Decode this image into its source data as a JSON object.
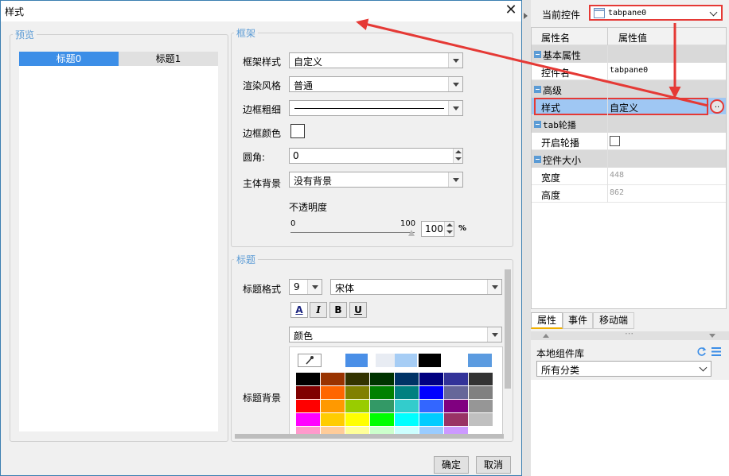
{
  "dialog": {
    "title": "样式",
    "close_glyph": "✕",
    "ok_label": "确定",
    "cancel_label": "取消"
  },
  "preview": {
    "group_label": "预览",
    "tabs": [
      "标题0",
      "标题1"
    ]
  },
  "frame": {
    "group_label": "框架",
    "style_label": "框架样式",
    "style_value": "自定义",
    "render_label": "渲染风格",
    "render_value": "普通",
    "border_width_label": "边框粗细",
    "border_color_label": "边框颜色",
    "radius_label": "圆角:",
    "radius_value": "0",
    "background_label": "主体背景",
    "background_value": "没有背景",
    "opacity_label": "不透明度",
    "opacity_min": "0",
    "opacity_max": "100",
    "opacity_value": "100",
    "opacity_unit": "%",
    "opacity_level": 1.0
  },
  "title_section": {
    "group_label": "标题",
    "format_label": "标题格式",
    "font_size": "9",
    "font_name": "宋体",
    "bold_glyph": "B",
    "italic_glyph": "I",
    "underline_glyph": "U",
    "fontcolor_glyph": "A",
    "background_label": "标题背景",
    "color_mode": "颜色",
    "recent_colors": [
      "#4a8fe7",
      "#e8ecf3",
      "#a6cdf5",
      "#000000",
      "#ffffff",
      "#5b9be0"
    ],
    "palette": [
      [
        "#000000",
        "#993300",
        "#333300",
        "#003300",
        "#003366",
        "#000080",
        "#333399",
        "#333333"
      ],
      [
        "#800000",
        "#ff6600",
        "#808000",
        "#008000",
        "#008080",
        "#0000ff",
        "#666699",
        "#808080"
      ],
      [
        "#ff0000",
        "#ff9900",
        "#99cc00",
        "#339966",
        "#33cccc",
        "#3366ff",
        "#800080",
        "#969696"
      ],
      [
        "#ff00ff",
        "#ffcc00",
        "#ffff00",
        "#00ff00",
        "#00ffff",
        "#00ccff",
        "#993366",
        "#c0c0c0"
      ],
      [
        "#ff99cc",
        "#ffcc99",
        "#ffff99",
        "#ccffcc",
        "#ccffff",
        "#99ccff",
        "#cc99ff",
        "#ffffff"
      ]
    ]
  },
  "panel": {
    "current_control_label": "当前控件",
    "current_control_value": "tabpane0",
    "col_name": "属性名",
    "col_value": "属性值",
    "categories": {
      "basic": "基本属性",
      "advanced": "高级",
      "carousel": "tab轮播",
      "size": "控件大小"
    },
    "rows": {
      "name_key": "控件名",
      "name_value": "tabpane0",
      "style_key": "样式",
      "style_value": "自定义",
      "style_more": "..",
      "carousel_key": "开启轮播",
      "width_key": "宽度",
      "width_value": "448",
      "height_key": "高度",
      "height_value": "862"
    },
    "tabs": [
      "属性",
      "事件",
      "移动端"
    ],
    "grip": "⋯",
    "library_label": "本地组件库",
    "library_category": "所有分类"
  },
  "colors": {
    "accent": "#3c8ee7",
    "annotation_red": "#e53935",
    "selection": "#9fc7f3"
  }
}
